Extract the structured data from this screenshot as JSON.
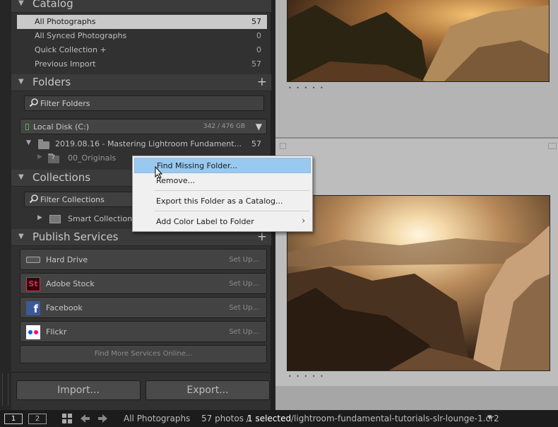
{
  "catalog": {
    "title": "Catalog",
    "items": [
      {
        "label": "All Photographs",
        "count": "57"
      },
      {
        "label": "All Synced Photographs",
        "count": "0"
      },
      {
        "label": "Quick Collection  +",
        "count": "0"
      },
      {
        "label": "Previous Import",
        "count": "57"
      }
    ]
  },
  "folders": {
    "title": "Folders",
    "filter_label": "Filter Folders",
    "disk": {
      "label": "Local Disk (C:)",
      "size": "342 / 476 GB"
    },
    "root_folder": {
      "label": "2019.08.16 - Mastering Lightroom Fundament...",
      "count": "57"
    },
    "sub_folder": {
      "label": "00_Originals",
      "badge": "?"
    }
  },
  "collections": {
    "title": "Collections",
    "filter_label": "Filter Collections",
    "smart_collections": "Smart Collections"
  },
  "publish": {
    "title": "Publish Services",
    "services": [
      {
        "label": "Hard Drive",
        "action": "Set Up..."
      },
      {
        "label": "Adobe Stock",
        "action": "Set Up...",
        "icon_text": "St"
      },
      {
        "label": "Facebook",
        "action": "Set Up...",
        "icon_text": "f"
      },
      {
        "label": "Flickr",
        "action": "Set Up..."
      }
    ],
    "find_more": "Find More Services Online..."
  },
  "buttons": {
    "import": "Import...",
    "export": "Export..."
  },
  "context_menu": {
    "items": [
      "Find Missing Folder...",
      "Remove...",
      "Export this Folder as a Catalog...",
      "Add Color Label to Folder"
    ],
    "submenu_arrow": "›"
  },
  "filmstrip": {
    "monitor1": "1",
    "monitor2": "2",
    "source": "All Photographs",
    "count_text": "57 photos /",
    "selected_text": "1 selected",
    "path": "/lightroom-fundamental-tutorials-slr-lounge-1.cr2",
    "dropdown": "▾"
  },
  "colors": {
    "panel_bg": "#313131",
    "header_bg": "#3b3b3b",
    "selected_row": "#c9c9c9",
    "menu_hover": "#99c9ef",
    "grid_bg": "#a6a6a6"
  }
}
